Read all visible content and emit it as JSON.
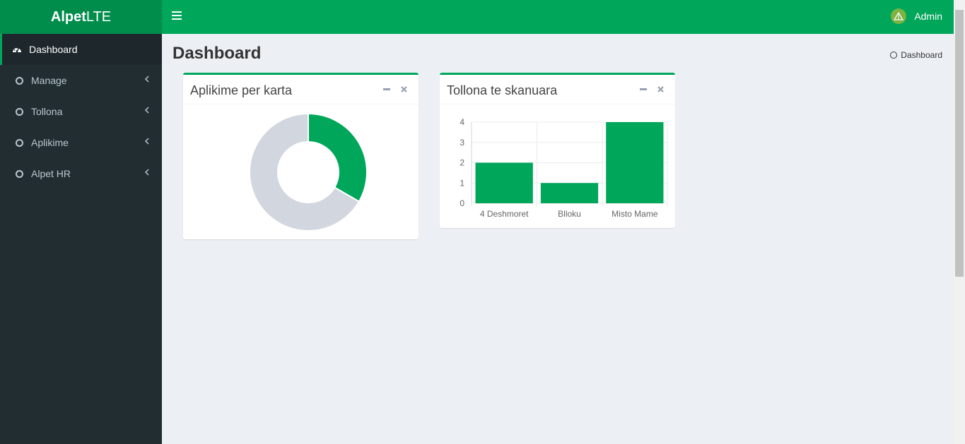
{
  "brand": {
    "bold": "Alpet",
    "light": "LTE"
  },
  "sidebar": {
    "items": [
      {
        "label": "Dashboard",
        "icon": "dashboard-icon",
        "active": true
      },
      {
        "label": "Manage",
        "icon": "circle-o-icon"
      },
      {
        "label": "Tollona",
        "icon": "circle-o-icon"
      },
      {
        "label": "Aplikime",
        "icon": "circle-o-icon"
      },
      {
        "label": "Alpet HR",
        "icon": "circle-o-icon"
      }
    ]
  },
  "header": {
    "user_name": "Admin",
    "toggle_icon": "bars-icon"
  },
  "page": {
    "title": "Dashboard",
    "breadcrumb": "Dashboard"
  },
  "colors": {
    "accent": "#00a65a",
    "accent_dark": "#008d4c",
    "sidebar_bg": "#222d32",
    "donut_rest": "#d2d6de"
  },
  "boxes": [
    {
      "title": "Aplikime per karta"
    },
    {
      "title": "Tollona te skanuara"
    }
  ],
  "chart_data": [
    {
      "type": "pie",
      "values": [
        1,
        2
      ],
      "colors": [
        "#00a65a",
        "#d2d6de"
      ]
    },
    {
      "type": "bar",
      "categories": [
        "4 Deshmoret",
        "Blloku",
        "Misto Mame"
      ],
      "values": [
        2,
        1,
        4
      ],
      "ylim": [
        0,
        4
      ],
      "yticks": [
        "0",
        "1",
        "2",
        "3",
        "4"
      ],
      "color": "#00a65a",
      "grid": true
    }
  ]
}
